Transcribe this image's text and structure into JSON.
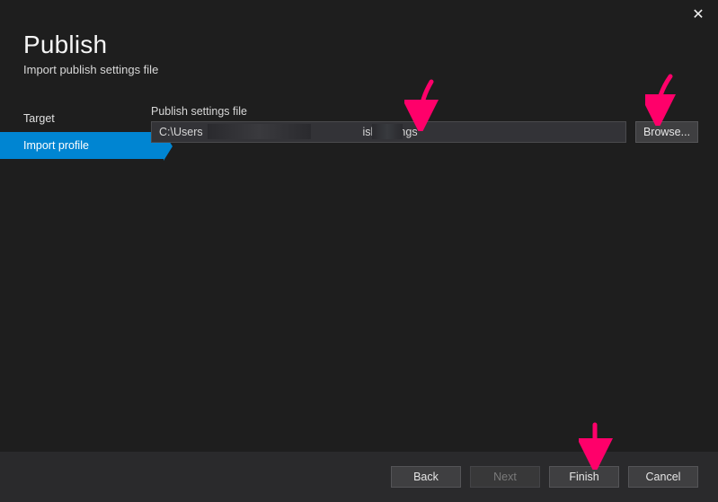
{
  "window": {
    "title": "Publish",
    "subtitle": "Import publish settings file"
  },
  "sidebar": {
    "items": [
      {
        "label": "Target",
        "active": false
      },
      {
        "label": "Import profile",
        "active": true
      }
    ]
  },
  "form": {
    "field_label": "Publish settings file",
    "input_prefix": "C:\\Users",
    "input_suffix": ".PublishSettings",
    "browse_label": "Browse..."
  },
  "footer": {
    "back": "Back",
    "next": "Next",
    "finish": "Finish",
    "cancel": "Cancel"
  },
  "icons": {
    "close": "✕"
  }
}
